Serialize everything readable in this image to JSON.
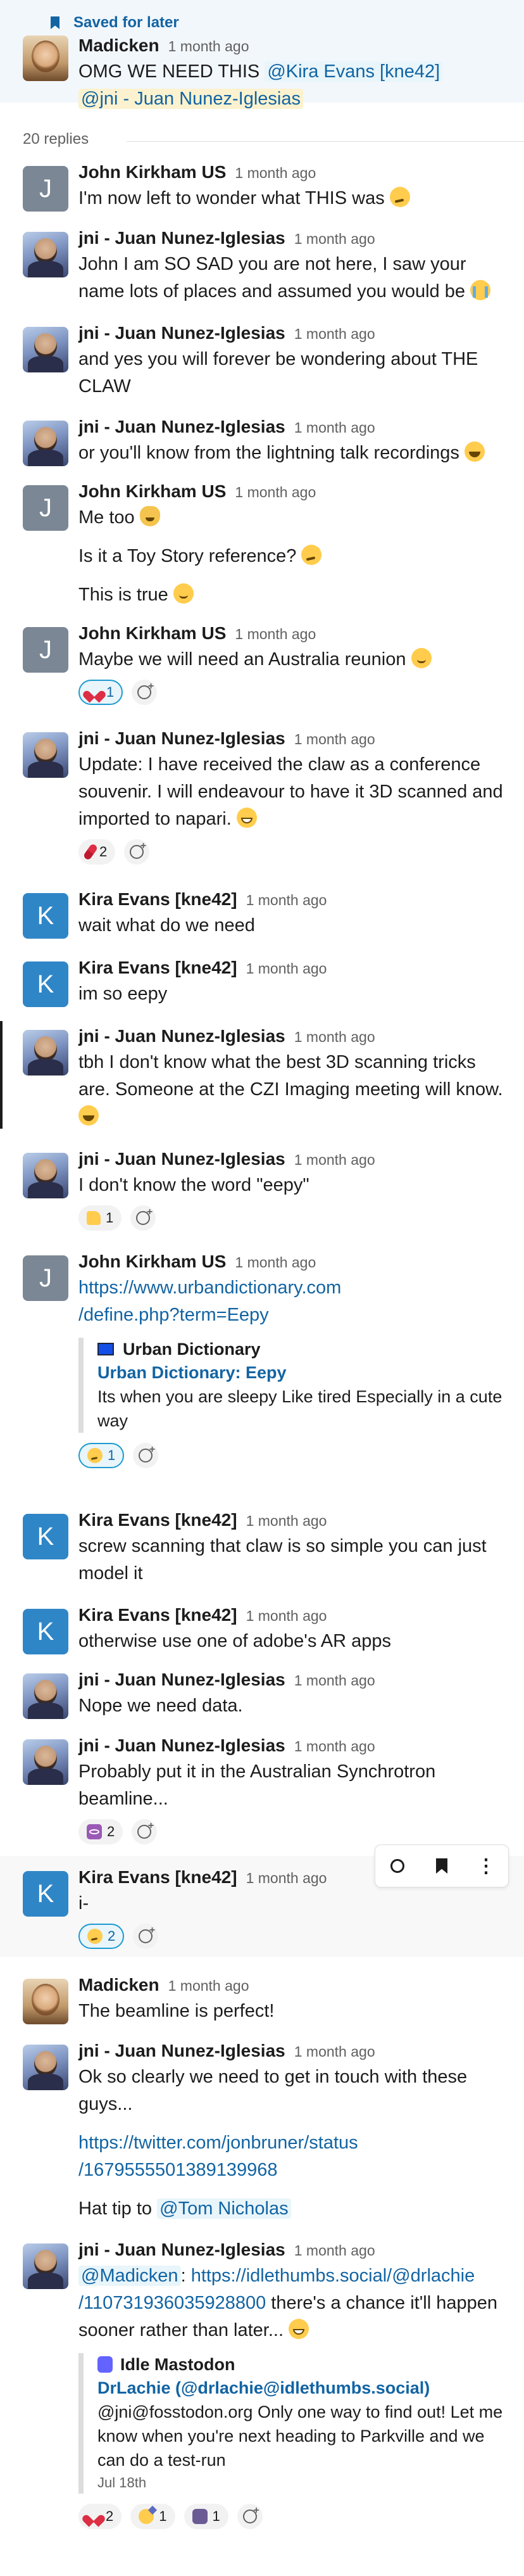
{
  "saved_label": "Saved for later",
  "parent": {
    "author": "Madicken",
    "time": "1 month ago",
    "text_prefix": "OMG WE NEED THIS",
    "mention1": "@Kira Evans [kne42]",
    "mention2": "@jni - Juan Nunez-Iglesias"
  },
  "replies_count": "20 replies",
  "messages": [
    {
      "author": "John Kirkham US",
      "time": "1 month ago",
      "text": "I'm now left to wonder what THIS was",
      "emoji": "thinking-face"
    },
    {
      "author": "jni - Juan Nunez-Iglesias",
      "time": "1 month ago",
      "text": "John I am SO SAD you are not here, I saw your name lots of places and assumed you would be",
      "emoji": "loudly-crying-face"
    },
    {
      "author": "jni - Juan Nunez-Iglesias",
      "time": "1 month ago",
      "text": "and yes you will forever be wondering about THE CLAW"
    },
    {
      "author": "jni - Juan Nunez-Iglesias",
      "time": "1 month ago",
      "text": "or you'll know from the lightning talk recordings",
      "emoji": "joy-face"
    },
    {
      "author": "John Kirkham US",
      "time": "1 month ago",
      "text": "Me too",
      "emoji": "cat-face",
      "text2": "Is it a Toy Story reference?",
      "emoji2": "thinking-face",
      "text3": "This is true",
      "emoji3": "slightly-smiling-face"
    },
    {
      "author": "John Kirkham US",
      "time": "1 month ago",
      "text": "Maybe we will need an Australia reunion",
      "emoji": "winking-face",
      "reactions": [
        {
          "icon": "heart",
          "count": "1"
        }
      ]
    },
    {
      "author": "jni - Juan Nunez-Iglesias",
      "time": "1 month ago",
      "text": "Update: I have received the claw as a conference souvenir. I will endeavour to have it 3D scanned and imported to napari.",
      "emoji": "grinning-face",
      "reactions": [
        {
          "icon": "pill",
          "count": "2"
        }
      ]
    },
    {
      "author": "Kira Evans [kne42]",
      "time": "1 month ago",
      "text": "wait what do we need"
    },
    {
      "author": "Kira Evans [kne42]",
      "time": "1 month ago",
      "text": "im so eepy"
    },
    {
      "author": "jni - Juan Nunez-Iglesias",
      "time": "1 month ago",
      "text": "tbh I don't know what the best 3D scanning tricks are. Someone at the CZI Imaging meeting will know.",
      "emoji": "joy-face"
    },
    {
      "author": "jni - Juan Nunez-Iglesias",
      "time": "1 month ago",
      "text": "I don't know the word \"eepy\"",
      "reactions": [
        {
          "icon": "thumbs-up",
          "count": "1"
        }
      ]
    },
    {
      "author": "John Kirkham US",
      "time": "1 month ago",
      "link": "https://www.urbandictionary.com/define.php?term=Eepy",
      "link_line1": "https://www.urbandictionary.com",
      "link_line2": "/define.php?term=Eepy",
      "unfurl": {
        "site": "Urban Dictionary",
        "title": "Urban Dictionary: Eepy",
        "desc": "Its when you are sleepy Like tired Especially in a cute way"
      },
      "reactions": [
        {
          "icon": "thinking-face",
          "count": "1"
        }
      ]
    },
    {
      "author": "Kira Evans [kne42]",
      "time": "1 month ago",
      "text": "screw scanning that claw is so simple you can just model it"
    },
    {
      "author": "Kira Evans [kne42]",
      "time": "1 month ago",
      "text": "otherwise use one of adobe's AR apps"
    },
    {
      "author": "jni - Juan Nunez-Iglesias",
      "time": "1 month ago",
      "text": "Nope we need data."
    },
    {
      "author": "jni - Juan Nunez-Iglesias",
      "time": "1 month ago",
      "text": "Probably put it in the Australian Synchrotron beamline...",
      "reactions": [
        {
          "icon": "atom",
          "count": "2"
        }
      ]
    },
    {
      "author": "Kira Evans [kne42]",
      "time": "1 month ago",
      "text": "i-",
      "reactions": [
        {
          "icon": "thinking-face",
          "count": "2"
        }
      ]
    },
    {
      "author": "Madicken",
      "time": "1 month ago",
      "text": "The beamline is perfect!"
    },
    {
      "author": "jni - Juan Nunez-Iglesias",
      "time": "1 month ago",
      "text": "Ok so clearly we need to get in touch with these guys...",
      "link_line1": "https://twitter.com/jonbruner/status",
      "link_line2": "/1679555501389139968",
      "hat_tip": "Hat tip to",
      "hat_mention": "@Tom Nicholas"
    },
    {
      "author": "jni - Juan Nunez-Iglesias",
      "time": "1 month ago",
      "mention": "@Madicken",
      "colon": ":",
      "link_line1": "https://idlethumbs.social/@drlachie",
      "link_line2": "/110731936035928800",
      "text_after": "there's a chance it'll happen sooner rather than later...",
      "emoji": "grinning-face",
      "unfurl": {
        "site": "Idle Mastodon",
        "title": "DrLachie (@drlachie@idlethumbs.social)",
        "desc": "@jni@fosstodon.org Only one way to find out! Let me know when you're next heading to Parkville and we can do a test-run",
        "date": "Jul 18th"
      },
      "reactions": [
        {
          "icon": "heart",
          "count": "2"
        },
        {
          "icon": "sparkle",
          "count": "1"
        },
        {
          "icon": "mascot",
          "count": "1"
        }
      ]
    }
  ]
}
